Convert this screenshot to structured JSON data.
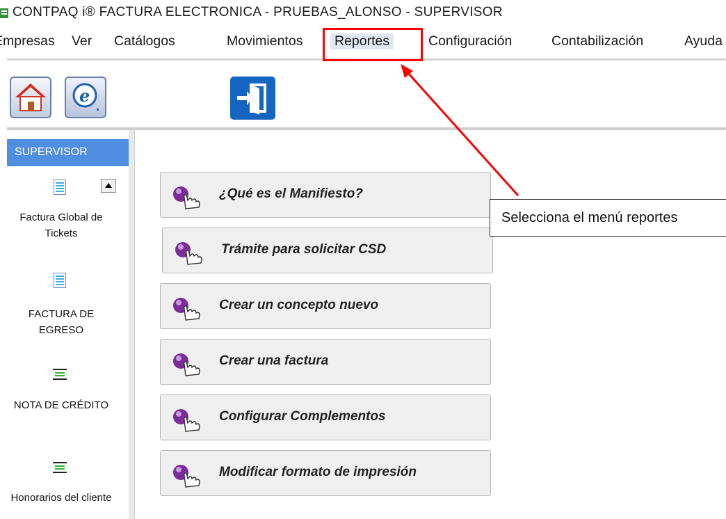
{
  "window": {
    "title": "CONTPAQ i® FACTURA ELECTRONICA  -  PRUEBAS_ALONSO  -  SUPERVISOR"
  },
  "menu": [
    {
      "label": "Empresas"
    },
    {
      "label": "Ver"
    },
    {
      "label": "Catálogos"
    },
    {
      "label": "Movimientos"
    },
    {
      "label": "Reportes"
    },
    {
      "label": "Configuración"
    },
    {
      "label": "Contabilización"
    },
    {
      "label": "Ayuda"
    }
  ],
  "toolbar": {
    "buttons": [
      "home-icon",
      "e-document-icon",
      "exit-door-icon"
    ]
  },
  "sidebar": {
    "header": "SUPERVISOR",
    "items": [
      {
        "label": "Factura Global de Tickets",
        "icon": "document-list-icon"
      },
      {
        "label": "FACTURA DE EGRESO",
        "icon": "document-list-icon"
      },
      {
        "label": "NOTA DE CRÉDITO",
        "icon": "green-lines-icon"
      },
      {
        "label": "Honorarios del cliente",
        "icon": "green-lines-icon"
      }
    ]
  },
  "actions": [
    {
      "label": "¿Qué es el Manifiesto?"
    },
    {
      "label": "Trámite para solicitar CSD"
    },
    {
      "label": "Crear un concepto nuevo"
    },
    {
      "label": "Crear una factura"
    },
    {
      "label": "Configurar Complementos"
    },
    {
      "label": "Modificar formato de impresión"
    }
  ],
  "annotation": {
    "text": "Selecciona el menú reportes",
    "color": "#ff0000"
  }
}
